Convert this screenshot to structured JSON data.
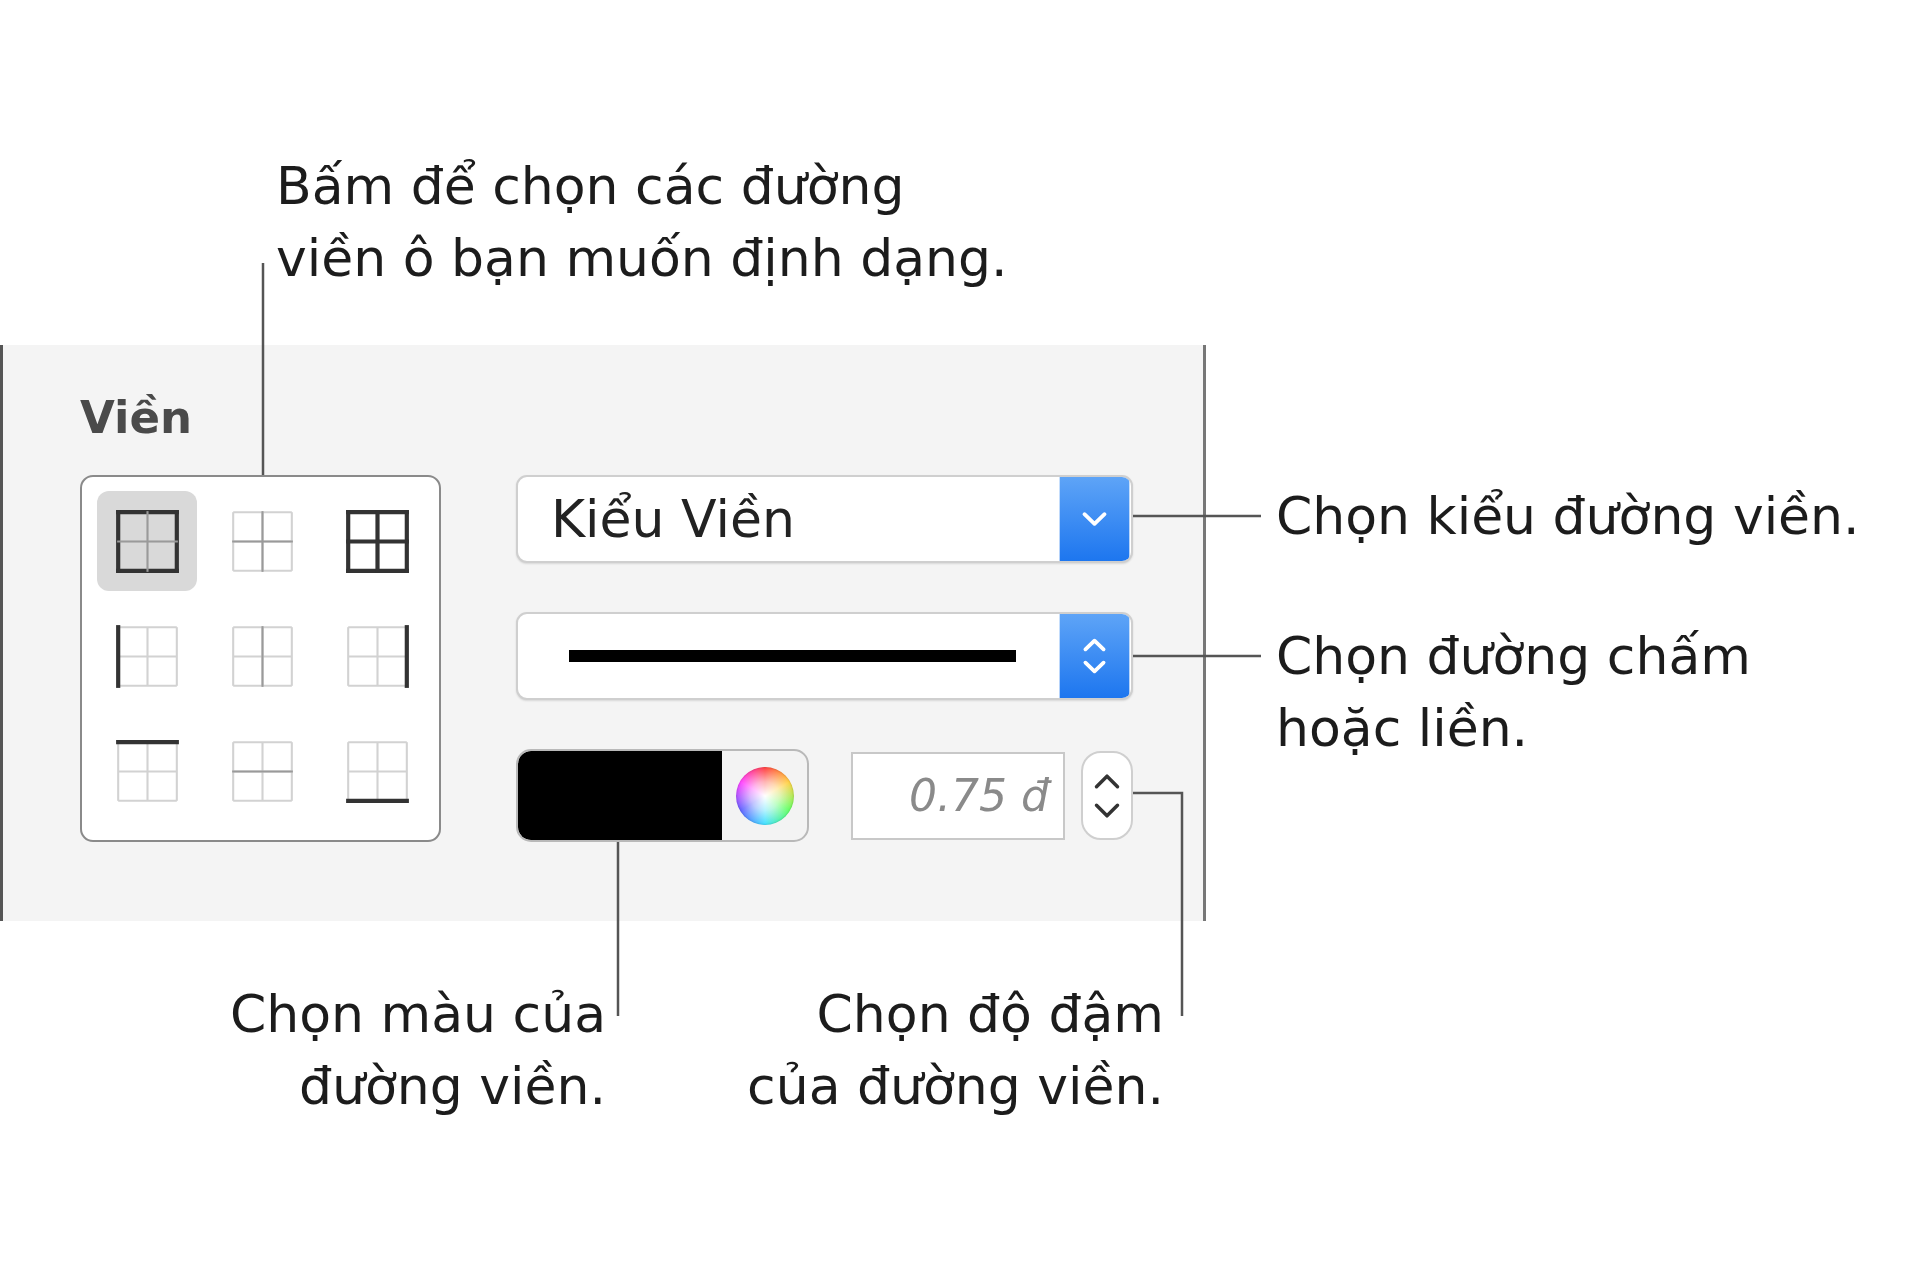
{
  "panel": {
    "title": "Viền",
    "border_presets": [
      {
        "kind": "outer",
        "selected": true
      },
      {
        "kind": "inner",
        "selected": false
      },
      {
        "kind": "all",
        "selected": false
      },
      {
        "kind": "left",
        "selected": false
      },
      {
        "kind": "inner-vertical",
        "selected": false
      },
      {
        "kind": "right",
        "selected": false
      },
      {
        "kind": "top",
        "selected": false
      },
      {
        "kind": "inner-horizontal",
        "selected": false
      },
      {
        "kind": "bottom",
        "selected": false
      }
    ],
    "border_style_menu": {
      "value": "Kiểu Viền"
    },
    "line_style_menu": {
      "kind": "solid"
    },
    "color_well": {
      "color": "#000000"
    },
    "width_field": {
      "value": "0.75 đ"
    }
  },
  "callouts": [
    {
      "lines": [
        "Bấm để chọn các đường",
        "viền ô bạn muốn định dạng."
      ]
    },
    {
      "lines": [
        "Chọn kiểu đường viền."
      ]
    },
    {
      "lines": [
        "Chọn đường chấm",
        "hoặc liền."
      ]
    },
    {
      "lines": [
        "Chọn màu của",
        "đường viền."
      ]
    },
    {
      "lines": [
        "Chọn độ đậm",
        "của đường viền."
      ]
    }
  ]
}
